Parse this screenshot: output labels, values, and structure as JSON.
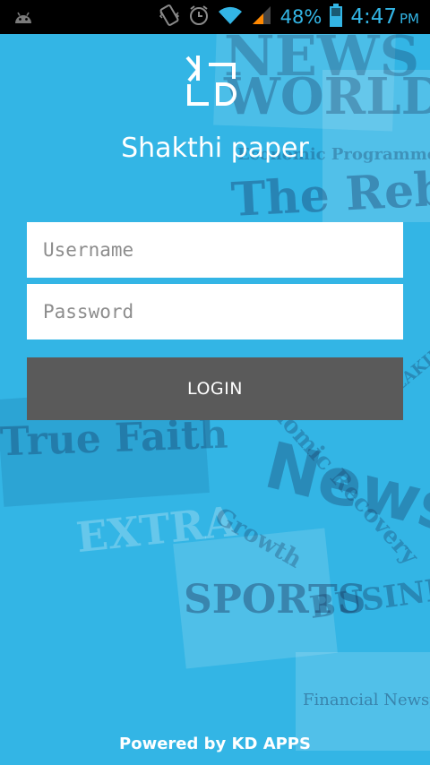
{
  "status_bar": {
    "battery_percent": "48%",
    "time": "4:47",
    "time_suffix": "PM",
    "icons": [
      "android-icon",
      "vibrate-icon",
      "alarm-icon",
      "wifi-icon",
      "signal-icon",
      "battery-icon"
    ]
  },
  "app": {
    "title": "Shakthi paper",
    "logo_text": "KD"
  },
  "form": {
    "username_placeholder": "Username",
    "password_placeholder": "Password",
    "login_label": "LOGIN"
  },
  "footer": {
    "text": "Powered by KD APPS"
  },
  "background_headlines": [
    "NEWS",
    "WORLD",
    "The Rebel So",
    "Economic Programme",
    "True Faith",
    "News",
    "SPORTS",
    "BUSINESS",
    "EXTRA",
    "Economic Recovery",
    "Growth",
    "Financial Newspa",
    "BREAKING"
  ],
  "colors": {
    "background": "#33b5e5",
    "button": "#5a5a5a",
    "status_bar": "#000000",
    "status_icons": "#33b5e5"
  }
}
